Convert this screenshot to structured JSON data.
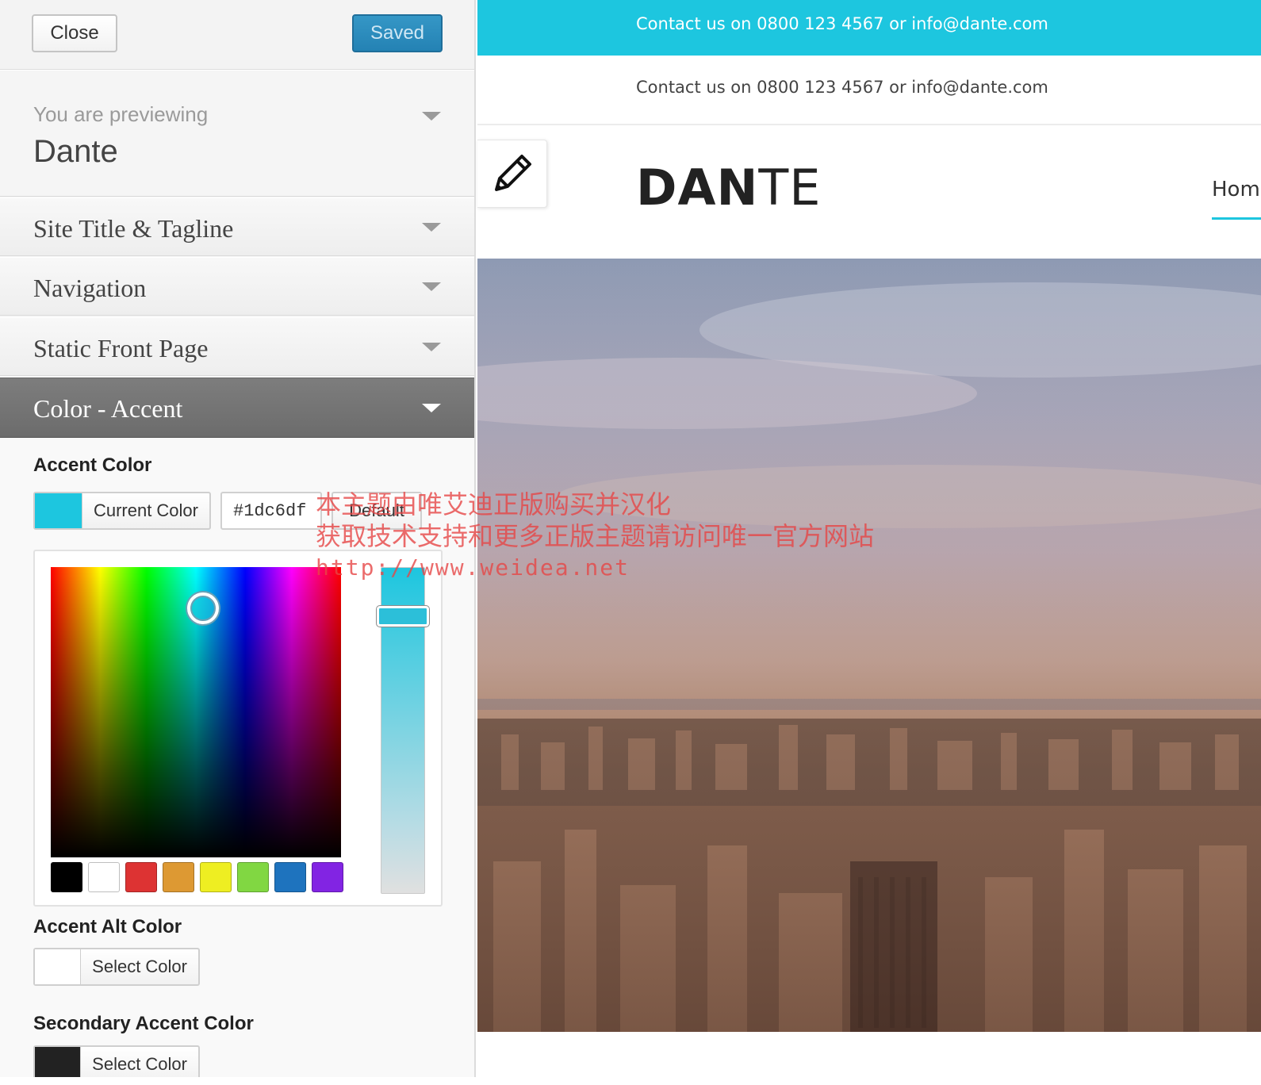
{
  "toolbar": {
    "close_label": "Close",
    "saved_label": "Saved"
  },
  "preview_info": {
    "label": "You are previewing",
    "theme": "Dante"
  },
  "sections": [
    {
      "label": "Site Title & Tagline"
    },
    {
      "label": "Navigation"
    },
    {
      "label": "Static Front Page"
    },
    {
      "label": "Color - Accent"
    }
  ],
  "accent": {
    "title": "Accent Color",
    "button_label": "Current Color",
    "value": "#1dc6df",
    "default_label": "Default",
    "swatch_color": "#1dc6df",
    "palette": [
      "#000000",
      "#ffffff",
      "#dd3333",
      "#dd9933",
      "#eeee22",
      "#81d742",
      "#1e73be",
      "#8224e3"
    ]
  },
  "accent_alt": {
    "title": "Accent Alt Color",
    "button_label": "Select Color",
    "swatch_color": "#ffffff"
  },
  "secondary_accent": {
    "title": "Secondary Accent Color",
    "button_label": "Select Color",
    "swatch_color": "#222222"
  },
  "site": {
    "topbar_text": "Contact us on 0800 123 4567 or info@dante.com",
    "subbar_text": "Contact us on 0800 123 4567 or info@dante.com",
    "logo_bold": "DAN",
    "logo_light": "TE",
    "nav_home": "Home",
    "accent_color": "#1dc6df"
  },
  "watermark": {
    "line1": "本主题由唯艾迪正版购买并汉化",
    "line2": "获取技术支持和更多正版主题请访问唯一官方网站",
    "line3": "http://www.weidea.net"
  }
}
